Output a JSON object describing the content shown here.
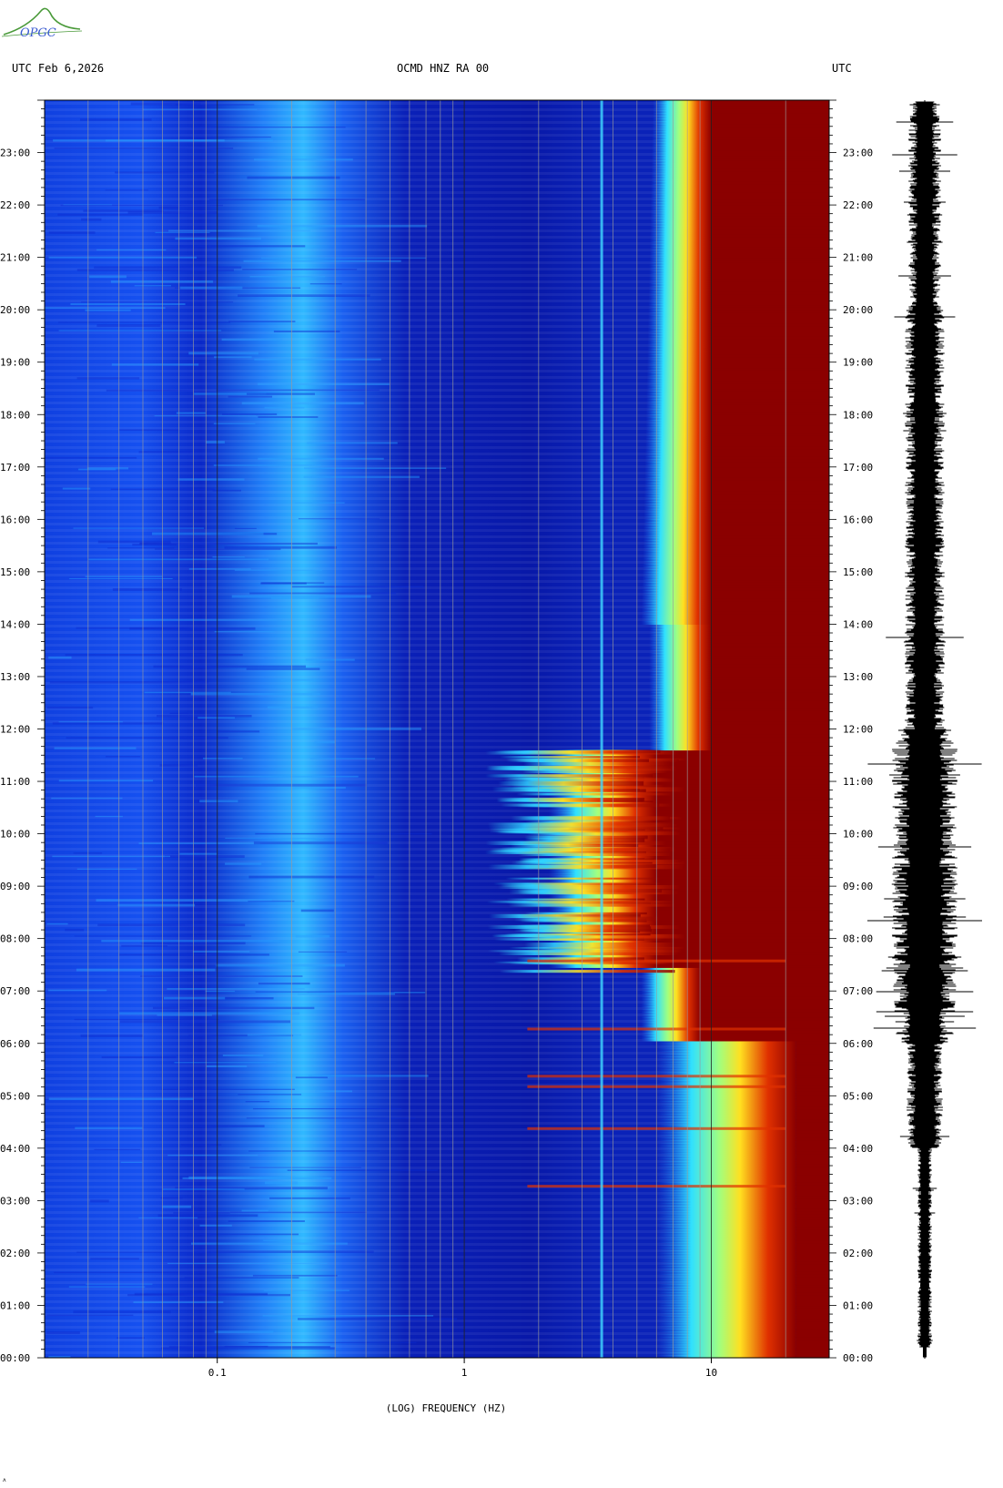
{
  "logo": {
    "text": "OPGC",
    "color": "#4a9a3a"
  },
  "header": {
    "left": "UTC  Feb 6,2026",
    "center": "OCMD HNZ RA 00",
    "right": "UTC"
  },
  "footer_mark": "ʌ",
  "colors": {
    "background_blue": "#0b1fb0",
    "mid_blue": "#1a5cf0",
    "cyan": "#30e0ff",
    "yellow": "#ffe020",
    "red": "#e02000",
    "dark_red": "#8b0000",
    "grid": "#9a9a9a"
  },
  "chart_data": {
    "type": "heatmap",
    "title": "OCMD HNZ RA 00",
    "xlabel": "(LOG) FREQUENCY (HZ)",
    "ylabel": "",
    "x_scale": "log",
    "xlim": [
      0.02,
      30
    ],
    "ylim_hours_utc": [
      0,
      24
    ],
    "x_tick_labels": [
      "0.1",
      "1",
      "10"
    ],
    "x_tick_values": [
      0.1,
      1,
      10
    ],
    "y_tick_labels_left": [
      "00:00",
      "01:00",
      "02:00",
      "03:00",
      "04:00",
      "05:00",
      "06:00",
      "07:00",
      "08:00",
      "09:00",
      "10:00",
      "11:00",
      "12:00",
      "13:00",
      "14:00",
      "15:00",
      "16:00",
      "17:00",
      "18:00",
      "19:00",
      "20:00",
      "21:00",
      "22:00",
      "23:00"
    ],
    "y_tick_labels_right": [
      "00:00",
      "01:00",
      "02:00",
      "03:00",
      "04:00",
      "05:00",
      "06:00",
      "07:00",
      "08:00",
      "09:00",
      "10:00",
      "11:00",
      "12:00",
      "13:00",
      "14:00",
      "15:00",
      "16:00",
      "17:00",
      "18:00",
      "19:00",
      "20:00",
      "21:00",
      "22:00",
      "23:00"
    ],
    "grid": true,
    "color_scale": [
      "dark blue (low power)",
      "cyan",
      "yellow",
      "red",
      "dark red (high power)"
    ],
    "features": [
      {
        "frequency_hz": 3.6,
        "description": "persistent narrow line"
      },
      {
        "hours_utc": [
          7.4,
          11.6
        ],
        "frequency_hz_min": 1.2,
        "description": "broadband energy"
      },
      {
        "hours_utc": [
          0,
          6
        ],
        "frequency_hz_min": 6,
        "description": "high-frequency energy"
      },
      {
        "hours_utc": [
          6,
          24
        ],
        "frequency_hz_min": 10,
        "description": "saturated high-frequency band"
      }
    ],
    "panels": [
      "spectrogram",
      "waveform trace"
    ]
  }
}
